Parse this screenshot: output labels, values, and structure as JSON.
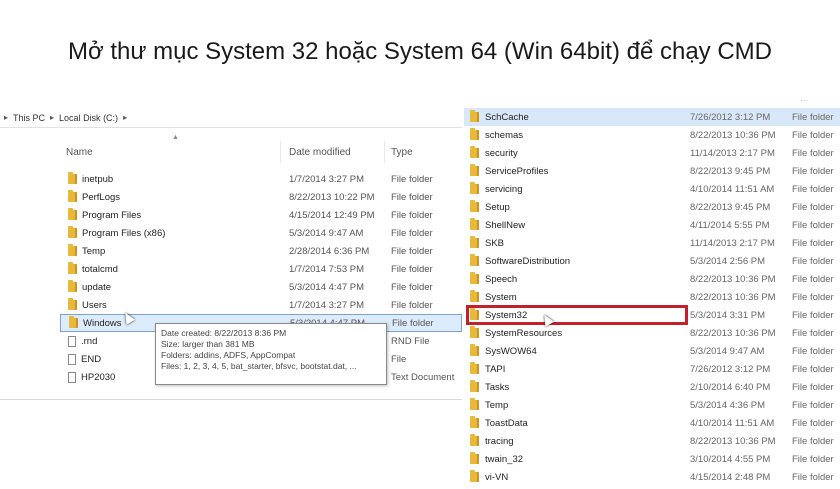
{
  "headline": "Mở thư mục System 32 hoặc System 64 (Win 64bit) để chạy CMD",
  "left_explorer": {
    "breadcrumb": [
      "This PC",
      "Local Disk (C:)"
    ],
    "columns": {
      "name": "Name",
      "date": "Date modified",
      "type": "Type"
    },
    "rows": [
      {
        "name": "inetpub",
        "date": "1/7/2014 3:27 PM",
        "type": "File folder",
        "icon": "folder-icon"
      },
      {
        "name": "PerfLogs",
        "date": "8/22/2013 10:22 PM",
        "type": "File folder",
        "icon": "folder-icon"
      },
      {
        "name": "Program Files",
        "date": "4/15/2014 12:49 PM",
        "type": "File folder",
        "icon": "folder-icon"
      },
      {
        "name": "Program Files (x86)",
        "date": "5/3/2014 9:47 AM",
        "type": "File folder",
        "icon": "folder-icon"
      },
      {
        "name": "Temp",
        "date": "2/28/2014 6:36 PM",
        "type": "File folder",
        "icon": "folder-icon"
      },
      {
        "name": "totalcmd",
        "date": "1/7/2014 7:53 PM",
        "type": "File folder",
        "icon": "folder-icon"
      },
      {
        "name": "update",
        "date": "5/3/2014 4:47 PM",
        "type": "File folder",
        "icon": "folder-icon"
      },
      {
        "name": "Users",
        "date": "1/7/2014 3:27 PM",
        "type": "File folder",
        "icon": "folder-icon"
      },
      {
        "name": "Windows",
        "date": "5/3/2014 4:47 PM",
        "type": "File folder",
        "icon": "folder-icon",
        "selected": true
      },
      {
        "name": ".rnd",
        "date": "",
        "type": "RND File",
        "icon": "file-icon"
      },
      {
        "name": "END",
        "date": "",
        "type": "File",
        "icon": "file-icon"
      },
      {
        "name": "HP2030",
        "date": "",
        "type": "Text Document",
        "icon": "file-icon"
      }
    ],
    "tooltip": [
      "Date created: 8/22/2013 8:36 PM",
      "Size: larger than 381 MB",
      "Folders: addins, ADFS, AppCompat",
      "Files: 1, 2, 3, 4, 5, bat_starter, bfsvc, bootstat.dat, ..."
    ]
  },
  "right_explorer": {
    "rows": [
      {
        "name": "SchCache",
        "date": "7/26/2012 3:12 PM",
        "type": "File folder",
        "highlighted": true
      },
      {
        "name": "schemas",
        "date": "8/22/2013 10:36 PM",
        "type": "File folder"
      },
      {
        "name": "security",
        "date": "11/14/2013 2:17 PM",
        "type": "File folder"
      },
      {
        "name": "ServiceProfiles",
        "date": "8/22/2013 9:45 PM",
        "type": "File folder"
      },
      {
        "name": "servicing",
        "date": "4/10/2014 11:51 AM",
        "type": "File folder"
      },
      {
        "name": "Setup",
        "date": "8/22/2013 9:45 PM",
        "type": "File folder"
      },
      {
        "name": "ShellNew",
        "date": "4/11/2014 5:55 PM",
        "type": "File folder"
      },
      {
        "name": "SKB",
        "date": "11/14/2013 2:17 PM",
        "type": "File folder"
      },
      {
        "name": "SoftwareDistribution",
        "date": "5/3/2014 2:56 PM",
        "type": "File folder"
      },
      {
        "name": "Speech",
        "date": "8/22/2013 10:36 PM",
        "type": "File folder"
      },
      {
        "name": "System",
        "date": "8/22/2013 10:36 PM",
        "type": "File folder"
      },
      {
        "name": "System32",
        "date": "5/3/2014 3:31 PM",
        "type": "File folder",
        "boxed": true
      },
      {
        "name": "SystemResources",
        "date": "8/22/2013 10:36 PM",
        "type": "File folder"
      },
      {
        "name": "SysWOW64",
        "date": "5/3/2014 9:47 AM",
        "type": "File folder"
      },
      {
        "name": "TAPI",
        "date": "7/26/2012 3:12 PM",
        "type": "File folder"
      },
      {
        "name": "Tasks",
        "date": "2/10/2014 6:40 PM",
        "type": "File folder"
      },
      {
        "name": "Temp",
        "date": "5/3/2014 4:36 PM",
        "type": "File folder"
      },
      {
        "name": "ToastData",
        "date": "4/10/2014 11:51 AM",
        "type": "File folder"
      },
      {
        "name": "tracing",
        "date": "8/22/2013 10:36 PM",
        "type": "File folder"
      },
      {
        "name": "twain_32",
        "date": "3/10/2014 4:55 PM",
        "type": "File folder"
      },
      {
        "name": "vi-VN",
        "date": "4/15/2014 2:48 PM",
        "type": "File folder"
      }
    ]
  },
  "colors": {
    "highlight_box": "#c2202a",
    "selection": "#dcecfc",
    "folder": "#e8b83a"
  }
}
